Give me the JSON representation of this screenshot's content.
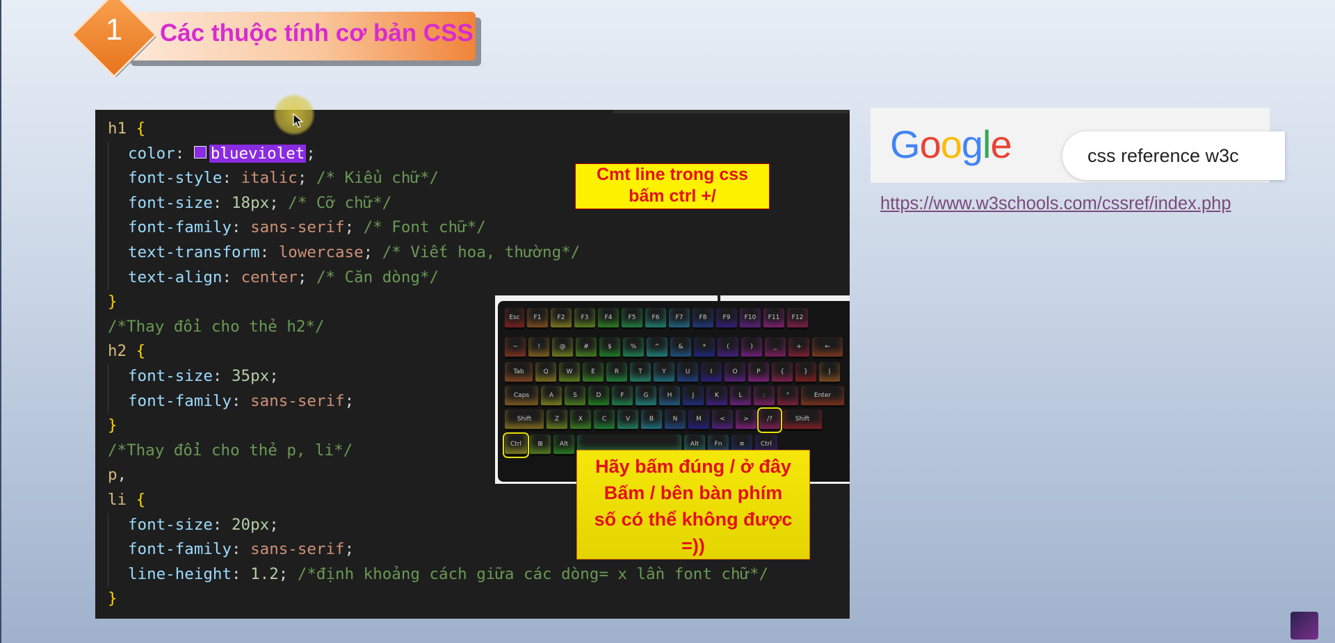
{
  "slide": {
    "number": "1",
    "title": "Các thuộc tính cơ bản CSS"
  },
  "code": {
    "lines": [
      {
        "indent": 0,
        "tokens": [
          {
            "t": "sel",
            "v": "h1"
          },
          {
            "t": "plain",
            "v": " "
          },
          {
            "t": "brace",
            "v": "{"
          }
        ]
      },
      {
        "indent": 1,
        "tokens": [
          {
            "t": "prop",
            "v": "color"
          },
          {
            "t": "plain",
            "v": ": "
          },
          {
            "t": "swatch",
            "v": ""
          },
          {
            "t": "hl",
            "v": "blueviolet"
          },
          {
            "t": "plain",
            "v": ";"
          }
        ]
      },
      {
        "indent": 1,
        "tokens": [
          {
            "t": "prop",
            "v": "font-style"
          },
          {
            "t": "plain",
            "v": ": "
          },
          {
            "t": "val",
            "v": "italic"
          },
          {
            "t": "plain",
            "v": "; "
          },
          {
            "t": "cmt",
            "v": "/* Kiểu chữ*/"
          }
        ]
      },
      {
        "indent": 1,
        "tokens": [
          {
            "t": "prop",
            "v": "font-size"
          },
          {
            "t": "plain",
            "v": ": "
          },
          {
            "t": "num",
            "v": "18px"
          },
          {
            "t": "plain",
            "v": "; "
          },
          {
            "t": "cmt",
            "v": "/* Cỡ chữ*/"
          }
        ]
      },
      {
        "indent": 1,
        "tokens": [
          {
            "t": "prop",
            "v": "font-family"
          },
          {
            "t": "plain",
            "v": ": "
          },
          {
            "t": "val",
            "v": "sans-serif"
          },
          {
            "t": "plain",
            "v": "; "
          },
          {
            "t": "cmt",
            "v": "/* Font chữ*/"
          }
        ]
      },
      {
        "indent": 1,
        "tokens": [
          {
            "t": "prop",
            "v": "text-transform"
          },
          {
            "t": "plain",
            "v": ": "
          },
          {
            "t": "val",
            "v": "lowercase"
          },
          {
            "t": "plain",
            "v": "; "
          },
          {
            "t": "cmt",
            "v": "/* Viết hoa, thường*/"
          }
        ]
      },
      {
        "indent": 1,
        "tokens": [
          {
            "t": "prop",
            "v": "text-align"
          },
          {
            "t": "plain",
            "v": ": "
          },
          {
            "t": "val",
            "v": "center"
          },
          {
            "t": "plain",
            "v": "; "
          },
          {
            "t": "cmt",
            "v": "/* Căn dòng*/"
          }
        ]
      },
      {
        "indent": 0,
        "tokens": [
          {
            "t": "brace",
            "v": "}"
          }
        ]
      },
      {
        "indent": 0,
        "tokens": [
          {
            "t": "cmt",
            "v": "/*Thay đổi cho thẻ h2*/"
          }
        ]
      },
      {
        "indent": 0,
        "tokens": [
          {
            "t": "sel",
            "v": "h2"
          },
          {
            "t": "plain",
            "v": " "
          },
          {
            "t": "brace",
            "v": "{"
          }
        ]
      },
      {
        "indent": 1,
        "tokens": [
          {
            "t": "prop",
            "v": "font-size"
          },
          {
            "t": "plain",
            "v": ": "
          },
          {
            "t": "num",
            "v": "35px"
          },
          {
            "t": "plain",
            "v": ";"
          }
        ]
      },
      {
        "indent": 1,
        "tokens": [
          {
            "t": "prop",
            "v": "font-family"
          },
          {
            "t": "plain",
            "v": ": "
          },
          {
            "t": "val",
            "v": "sans-serif"
          },
          {
            "t": "plain",
            "v": ";"
          }
        ]
      },
      {
        "indent": 0,
        "tokens": [
          {
            "t": "brace",
            "v": "}"
          }
        ]
      },
      {
        "indent": 0,
        "tokens": [
          {
            "t": "cmt",
            "v": "/*Thay đổi cho thẻ p, li*/"
          }
        ]
      },
      {
        "indent": 0,
        "tokens": [
          {
            "t": "sel",
            "v": "p"
          },
          {
            "t": "plain",
            "v": ","
          }
        ]
      },
      {
        "indent": 0,
        "tokens": [
          {
            "t": "sel",
            "v": "li"
          },
          {
            "t": "plain",
            "v": " "
          },
          {
            "t": "brace",
            "v": "{"
          }
        ]
      },
      {
        "indent": 1,
        "tokens": [
          {
            "t": "prop",
            "v": "font-size"
          },
          {
            "t": "plain",
            "v": ": "
          },
          {
            "t": "num",
            "v": "20px"
          },
          {
            "t": "plain",
            "v": ";"
          }
        ]
      },
      {
        "indent": 1,
        "tokens": [
          {
            "t": "prop",
            "v": "font-family"
          },
          {
            "t": "plain",
            "v": ": "
          },
          {
            "t": "val",
            "v": "sans-serif"
          },
          {
            "t": "plain",
            "v": ";"
          }
        ]
      },
      {
        "indent": 1,
        "tokens": [
          {
            "t": "prop",
            "v": "line-height"
          },
          {
            "t": "plain",
            "v": ": "
          },
          {
            "t": "num",
            "v": "1.2"
          },
          {
            "t": "plain",
            "v": "; "
          },
          {
            "t": "cmt",
            "v": "/*định khoảng cách giữa các dòng= x lần font chữ*/"
          }
        ]
      },
      {
        "indent": 0,
        "tokens": [
          {
            "t": "brace",
            "v": "}"
          }
        ]
      }
    ],
    "swatch_color": "#8a2be2"
  },
  "notes": {
    "comment_tip": {
      "line1": "Cmt line trong css",
      "line2": "bấm ctrl +/"
    },
    "slash_tip": {
      "line1": "Hãy bấm đúng / ở đây",
      "line2": "Bấm / bên bàn phím",
      "line3": "số có thể không được",
      "line4": "=))"
    }
  },
  "keyboard": {
    "rows": [
      [
        "Esc",
        "F1",
        "F2",
        "F3",
        "F4",
        "F5",
        "F6",
        "F7",
        "F8",
        "F9",
        "F10",
        "F11",
        "F12"
      ],
      [
        "~",
        "!",
        "@",
        "#",
        "$",
        "%",
        "^",
        "&",
        "*",
        "(",
        ")",
        "_",
        "+",
        "←"
      ],
      [
        "Tab",
        "Q",
        "W",
        "E",
        "R",
        "T",
        "Y",
        "U",
        "I",
        "O",
        "P",
        "{",
        "}",
        "|"
      ],
      [
        "Caps",
        "A",
        "S",
        "D",
        "F",
        "G",
        "H",
        "J",
        "K",
        "L",
        ":",
        "\"",
        "Enter"
      ],
      [
        "Shift",
        "Z",
        "X",
        "C",
        "V",
        "B",
        "N",
        "M",
        "<",
        ">",
        "/?",
        "Shift"
      ],
      [
        "Ctrl",
        "⊞",
        "Alt",
        "",
        "Alt",
        "Fn",
        "≡",
        "Ctrl"
      ]
    ],
    "highlighted_keys": [
      "/?",
      "Ctrl"
    ]
  },
  "google": {
    "logo_letters": [
      "G",
      "o",
      "o",
      "g",
      "l",
      "e"
    ],
    "query": "css reference w3c"
  },
  "link": {
    "text": "https://www.w3schools.com/cssref/index.php"
  }
}
